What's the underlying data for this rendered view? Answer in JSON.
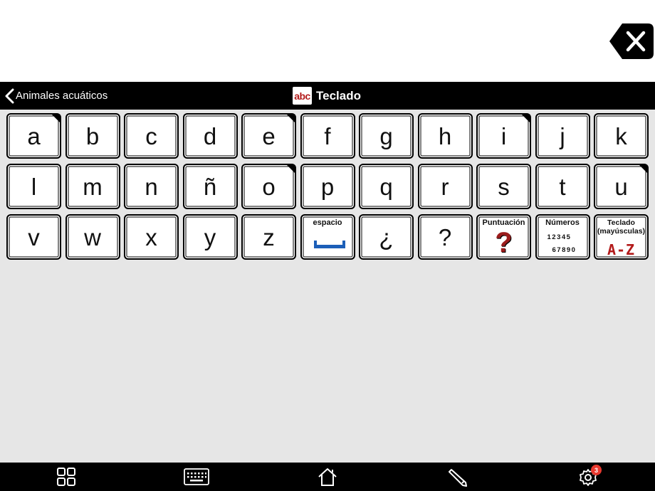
{
  "nav": {
    "back_label": "Animales acuáticos",
    "icon_text": "abc",
    "title": "Teclado"
  },
  "keys": {
    "row1": [
      "a",
      "b",
      "c",
      "d",
      "e",
      "f",
      "g",
      "h",
      "i",
      "j",
      "k"
    ],
    "row2": [
      "l",
      "m",
      "n",
      "ñ",
      "o",
      "p",
      "q",
      "r",
      "s",
      "t",
      "u"
    ],
    "row3": [
      "v",
      "w",
      "x",
      "y",
      "z"
    ]
  },
  "special": {
    "space_label": "espacio",
    "inverted_q": "¿",
    "question": "?",
    "punctuation_label": "Puntuación",
    "punctuation_symbol": "?",
    "numbers_label": "Números",
    "numbers_row1": "12345",
    "numbers_row2": "67890",
    "uppercase_label": "Teclado (mayúsculas)",
    "uppercase_symbol": "A-Z"
  },
  "toolbar": {
    "settings_badge": "3"
  },
  "colors": {
    "accent_red": "#b31b1b",
    "space_blue": "#1c5fb8",
    "badge_red": "#e8392f"
  }
}
